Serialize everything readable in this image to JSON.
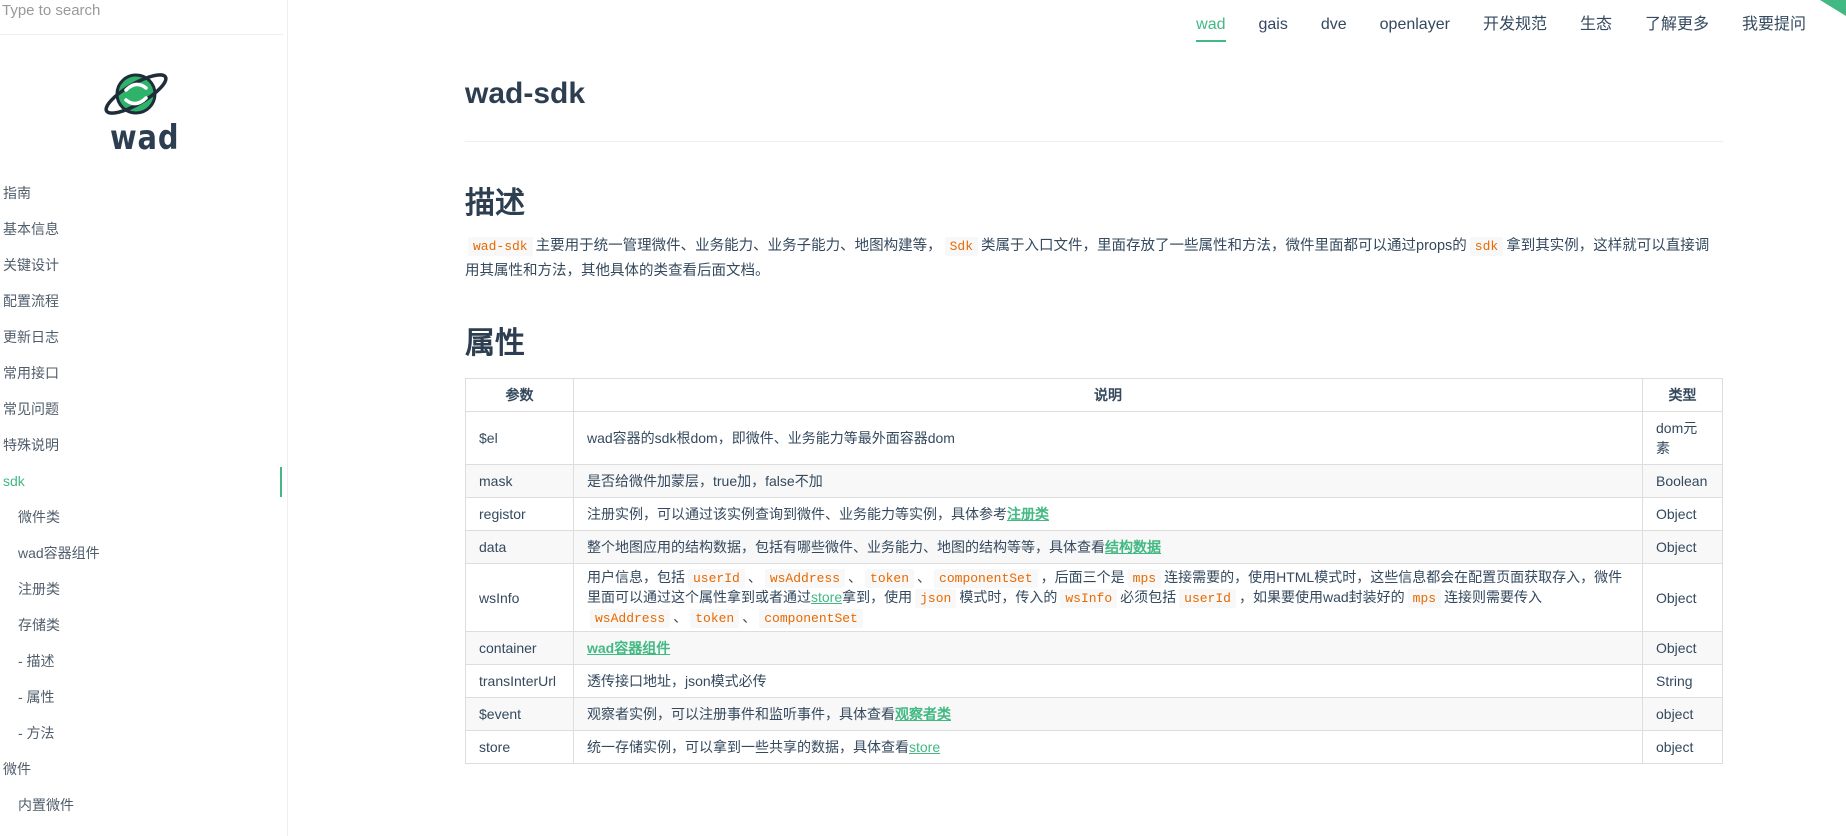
{
  "search": {
    "placeholder": "Type to search"
  },
  "logo": {
    "text": "wad"
  },
  "sidebar": {
    "items": [
      {
        "label": "指南"
      },
      {
        "label": "基本信息"
      },
      {
        "label": "关键设计"
      },
      {
        "label": "配置流程"
      },
      {
        "label": "更新日志"
      },
      {
        "label": "常用接口"
      },
      {
        "label": "常见问题"
      },
      {
        "label": "特殊说明"
      },
      {
        "label": "sdk"
      },
      {
        "label": "微件类"
      },
      {
        "label": "wad容器组件"
      },
      {
        "label": "注册类"
      },
      {
        "label": "存储类"
      },
      {
        "label": "- 描述"
      },
      {
        "label": "- 属性"
      },
      {
        "label": "- 方法"
      },
      {
        "label": "微件"
      },
      {
        "label": "内置微件"
      }
    ]
  },
  "topnav": {
    "items": [
      {
        "label": "wad"
      },
      {
        "label": "gais"
      },
      {
        "label": "dve"
      },
      {
        "label": "openlayer"
      },
      {
        "label": "开发规范"
      },
      {
        "label": "生态"
      },
      {
        "label": "了解更多"
      },
      {
        "label": "我要提问"
      }
    ]
  },
  "page": {
    "title": "wad-sdk",
    "desc_heading": "描述",
    "desc": {
      "code1": "wad-sdk",
      "t1": "主要用于统一管理微件、业务能力、业务子能力、地图构建等，",
      "code2": "Sdk",
      "t2": "类属于入口文件，里面存放了一些属性和方法，微件里面都可以通过props的",
      "code3": "sdk",
      "t3": "拿到其实例，这样就可以直接调用其属性和方法，其他具体的类查看后面文档。"
    },
    "attr_heading": "属性"
  },
  "table": {
    "headers": [
      "参数",
      "说明",
      "类型"
    ],
    "rows": {
      "el": {
        "param": "$el",
        "desc": "wad容器的sdk根dom，即微件、业务能力等最外面容器dom",
        "type": "dom元素"
      },
      "mask": {
        "param": "mask",
        "desc": "是否给微件加蒙层，true加，false不加",
        "type": "Boolean"
      },
      "registor": {
        "param": "registor",
        "desc": "注册实例，可以通过该实例查询到微件、业务能力等实例，具体参考",
        "link": "注册类",
        "type": "Object"
      },
      "data": {
        "param": "data",
        "desc": "整个地图应用的结构数据，包括有哪些微件、业务能力、地图的结构等等，具体查看",
        "link": "结构数据",
        "type": "Object"
      },
      "wsInfo": {
        "param": "wsInfo",
        "type": "Object",
        "t1": "用户信息，包括",
        "c1": "userId",
        "s1": "、",
        "c2": "wsAddress",
        "s2": "、",
        "c3": "token",
        "s3": "、",
        "c4": "componentSet",
        "t2": "，后面三个是",
        "c5": "mps",
        "t3": "连接需要的，使用HTML模式时，这些信息都会在配置页面获取存入，微件里面可以通过这个属性拿到或者通过",
        "link": "store",
        "t4": "拿到，使用",
        "c6": "json",
        "t5": "模式时，传入的",
        "c7": "wsInfo",
        "t6": "必须包括",
        "c8": "userId",
        "t7": "，如果要使用wad封装好的",
        "c9": "mps",
        "t8": "连接则需要传入",
        "c10": "wsAddress",
        "s4": "、",
        "c11": "token",
        "s5": "、",
        "c12": "componentSet"
      },
      "container": {
        "param": "container",
        "link": "wad容器组件",
        "type": "Object"
      },
      "transInterUrl": {
        "param": "transInterUrl",
        "desc": "透传接口地址，json模式必传",
        "type": "String"
      },
      "event": {
        "param": "$event",
        "desc": "观察者实例，可以注册事件和监听事件，具体查看",
        "link": "观察者类",
        "type": "object"
      },
      "store": {
        "param": "store",
        "desc": "统一存储实例，可以拿到一些共享的数据，具体查看",
        "link": "store",
        "type": "object"
      }
    }
  },
  "colors": {
    "accent": "#42b983",
    "code": "#e96900",
    "text": "#34495e"
  }
}
